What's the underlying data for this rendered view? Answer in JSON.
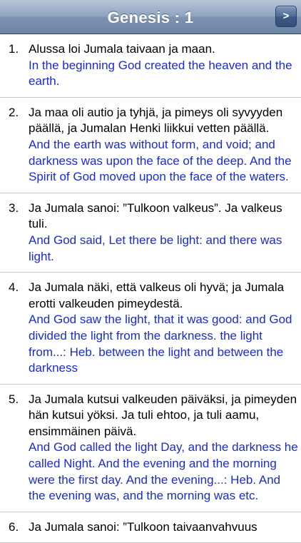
{
  "navbar": {
    "title": "Genesis : 1",
    "next_button_label": ">"
  },
  "colors": {
    "finnish_text": "#000000",
    "english_text": "#1a2bd6",
    "navbar": "#8fa4bf"
  },
  "verses": [
    {
      "number": "1.",
      "finnish": "Alussa loi Jumala taivaan ja maan.",
      "english": "In the beginning God created the heaven and the earth."
    },
    {
      "number": "2.",
      "finnish": "Ja maa oli autio ja tyhjä, ja pimeys oli syvyyden päällä, ja Jumalan Henki liikkui vetten päällä.",
      "english": "And the earth was without form, and void; and darkness was upon the face of the deep. And the Spirit of God moved upon the face of the waters."
    },
    {
      "number": "3.",
      "finnish": "Ja Jumala sanoi: ”Tulkoon valkeus”. Ja valkeus tuli.",
      "english": "And God said, Let there be light: and there was light."
    },
    {
      "number": "4.",
      "finnish": "Ja Jumala näki, että valkeus oli hyvä; ja Jumala erotti valkeuden pimeydestä.",
      "english": "And God saw the light, that it was good: and God divided the light from the darkness. the light from...: Heb. between the light and between the darkness"
    },
    {
      "number": "5.",
      "finnish": "Ja Jumala kutsui valkeuden päiväksi, ja pimeyden hän kutsui yöksi. Ja tuli ehtoo, ja tuli aamu, ensimmäinen päivä.",
      "english": "And God called the light Day, and the darkness he called Night. And the evening and the morning were the first day. And the evening...: Heb. And the evening was, and the morning was etc."
    },
    {
      "number": "6.",
      "finnish": "Ja Jumala sanoi: ”Tulkoon taivaanvahvuus",
      "english": ""
    }
  ]
}
